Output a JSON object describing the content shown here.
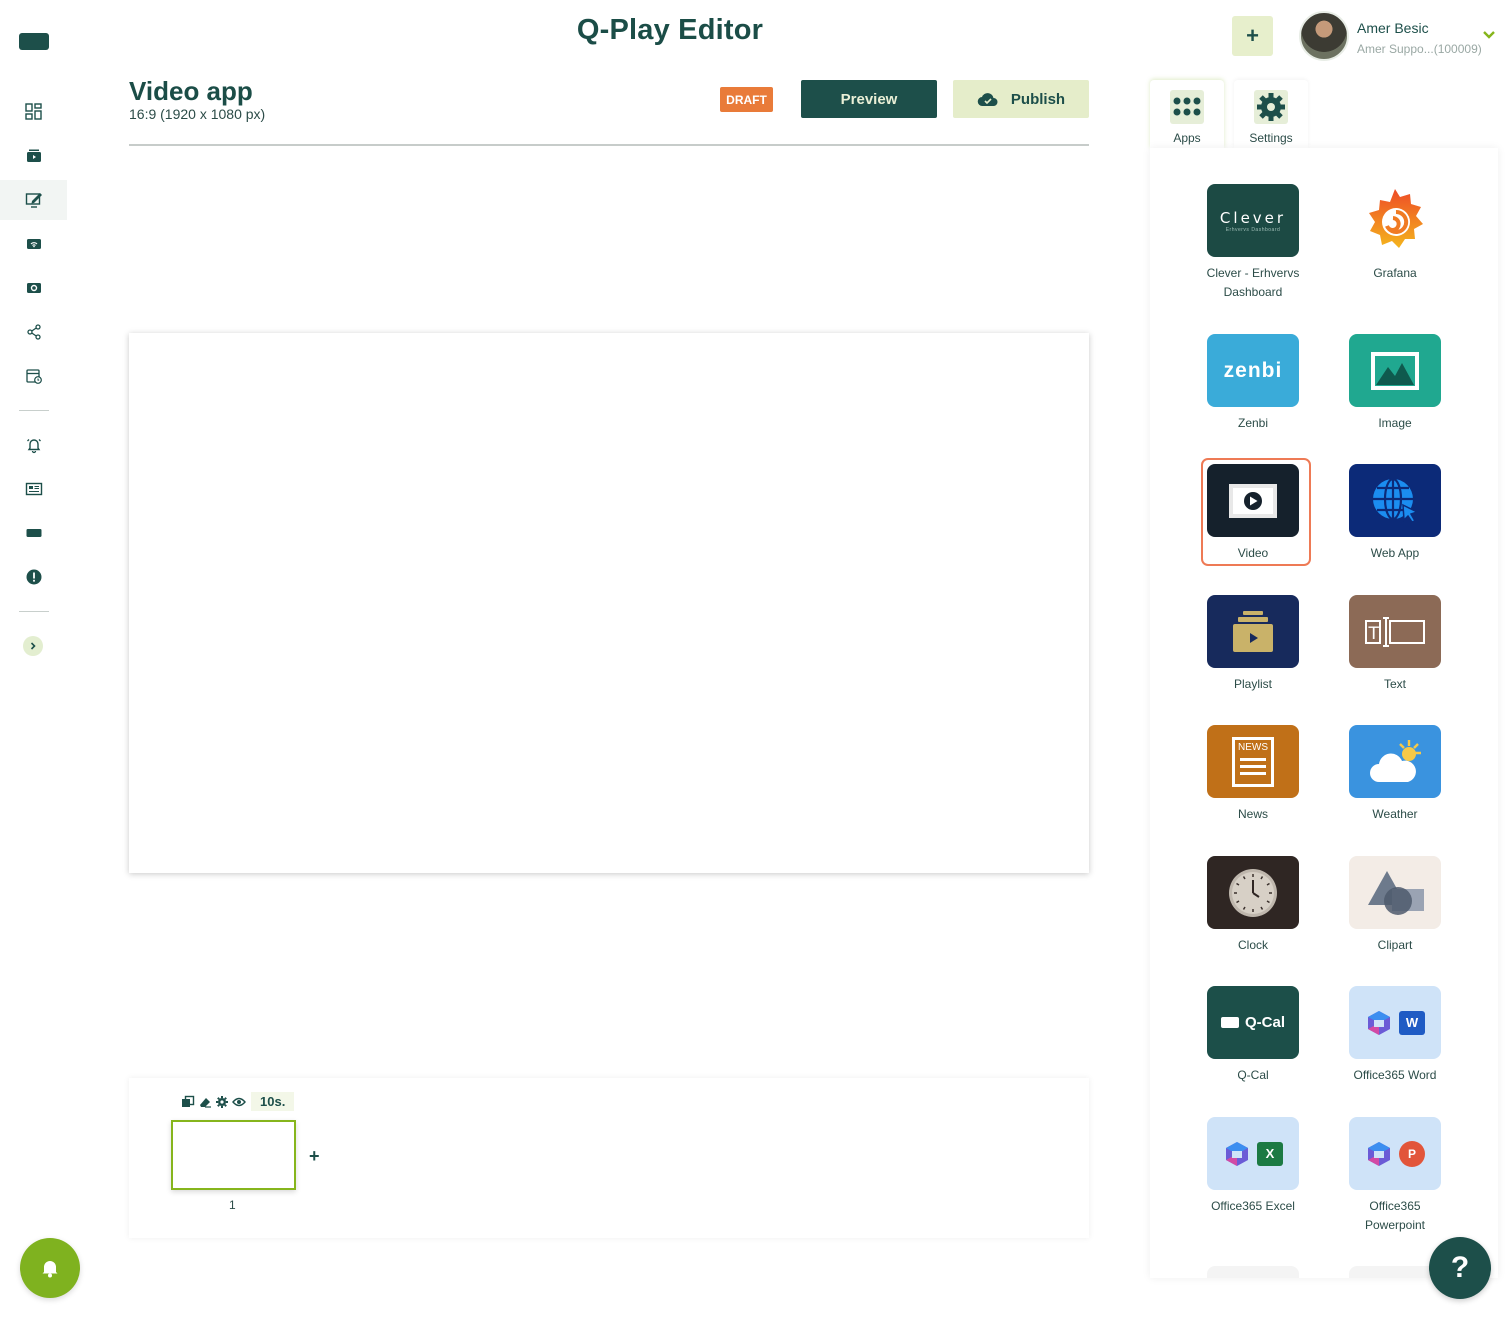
{
  "header": {
    "title": "Q-Play Editor",
    "add_label": "+",
    "user_name": "Amer Besic",
    "user_sub": "Amer Suppo...(100009)"
  },
  "page": {
    "name": "Video app",
    "resolution": "16:9 (1920 x 1080 px)",
    "status_badge": "DRAFT",
    "preview_label": "Preview",
    "publish_label": "Publish"
  },
  "sidebar": {
    "items": [
      {
        "icon": "dashboard-icon"
      },
      {
        "icon": "media-icon"
      },
      {
        "icon": "editor-icon",
        "active": true
      },
      {
        "icon": "screens-icon"
      },
      {
        "icon": "channels-icon"
      },
      {
        "icon": "share-icon"
      },
      {
        "icon": "schedule-icon"
      },
      {
        "icon": "alerts-icon"
      },
      {
        "icon": "news-icon"
      },
      {
        "icon": "qcal-icon"
      },
      {
        "icon": "info-icon"
      }
    ]
  },
  "timeline": {
    "duration": "10s.",
    "slide_number": "1",
    "add_label": "+"
  },
  "panel": {
    "tabs": [
      {
        "label": "Apps",
        "icon": "apps-grid-icon"
      },
      {
        "label": "Settings",
        "icon": "gear-icon"
      }
    ],
    "apps": [
      {
        "label": "Clever - Erhvervs Dashboard",
        "logo_text": "Clever",
        "logo_sub": "Erhvervs Dashboard",
        "color": "#1c4a44"
      },
      {
        "label": "Grafana",
        "color": "#ffffff"
      },
      {
        "label": "Zenbi",
        "logo_text": "zenbi",
        "color": "#3aabd9"
      },
      {
        "label": "Image",
        "color": "#20a890"
      },
      {
        "label": "Video",
        "color": "#15212c",
        "selected": true
      },
      {
        "label": "Web App",
        "color": "#0c2a78"
      },
      {
        "label": "Playlist",
        "color": "#172a5c"
      },
      {
        "label": "Text",
        "color": "#8c6a56"
      },
      {
        "label": "News",
        "logo_text": "NEWS",
        "color": "#c07018"
      },
      {
        "label": "Weather",
        "color": "#3a93df"
      },
      {
        "label": "Clock",
        "color": "#2f2623"
      },
      {
        "label": "Clipart",
        "color": "#f3ece6"
      },
      {
        "label": "Q-Cal",
        "logo_text": "Q-Cal",
        "color": "#1c4f49"
      },
      {
        "label": "Office365 Word",
        "logo_text": "W",
        "color": "#cfe3f8"
      },
      {
        "label": "Office365 Excel",
        "logo_text": "X",
        "color": "#cfe3f8"
      },
      {
        "label": "Office365 Powerpoint",
        "logo_text": "P",
        "color": "#cfe3f8"
      }
    ]
  },
  "help": {
    "label": "?"
  },
  "colors": {
    "brand": "#1d4f4a",
    "accent_green": "#7fb21f",
    "draft_orange": "#e97b39",
    "selected_outline": "#ee7a55"
  }
}
